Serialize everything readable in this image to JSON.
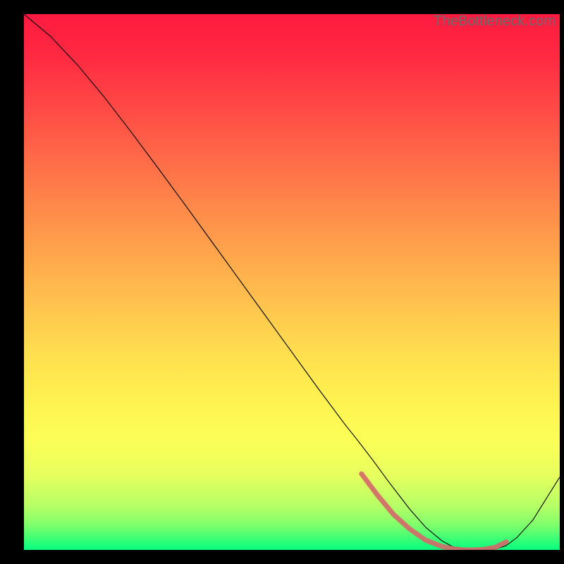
{
  "watermark": "TheBottleneck.com",
  "chart_data": {
    "type": "line",
    "title": "",
    "xlabel": "",
    "ylabel": "",
    "xlim": [
      0,
      100
    ],
    "ylim": [
      0,
      100
    ],
    "grid": false,
    "series": [
      {
        "name": "curve",
        "color": "#000000",
        "width": 1.1,
        "x": [
          0,
          5,
          10,
          15,
          20,
          25,
          30,
          35,
          40,
          45,
          50,
          55,
          60,
          62,
          65,
          68,
          70,
          72,
          75,
          78,
          80,
          82,
          85,
          88,
          90,
          92,
          95,
          100
        ],
        "y": [
          100,
          95.8,
          90.5,
          84.5,
          78.0,
          71.3,
          64.5,
          57.6,
          50.7,
          43.8,
          36.9,
          30.0,
          23.3,
          20.8,
          16.9,
          12.8,
          10.2,
          7.6,
          4.2,
          1.7,
          0.6,
          0.15,
          0.0,
          0.15,
          0.8,
          2.3,
          5.6,
          13.6
        ]
      },
      {
        "name": "highlight-band",
        "color": "#d46a6a",
        "width": 7,
        "cap": "round",
        "x": [
          63,
          66,
          69,
          72,
          75,
          78,
          80,
          82,
          84,
          86,
          88,
          90
        ],
        "y": [
          14.2,
          10.2,
          6.6,
          3.9,
          1.8,
          0.65,
          0.2,
          0.0,
          0.0,
          0.12,
          0.5,
          1.5
        ]
      }
    ],
    "gradient_stops": [
      {
        "pos": 0.0,
        "color": "#ff1a3f"
      },
      {
        "pos": 0.08,
        "color": "#ff2a42"
      },
      {
        "pos": 0.2,
        "color": "#ff5246"
      },
      {
        "pos": 0.35,
        "color": "#ff864a"
      },
      {
        "pos": 0.5,
        "color": "#ffb64d"
      },
      {
        "pos": 0.62,
        "color": "#ffdb4f"
      },
      {
        "pos": 0.72,
        "color": "#fff250"
      },
      {
        "pos": 0.8,
        "color": "#fbff57"
      },
      {
        "pos": 0.86,
        "color": "#e7ff5e"
      },
      {
        "pos": 0.92,
        "color": "#b4ff66"
      },
      {
        "pos": 0.955,
        "color": "#7cff6c"
      },
      {
        "pos": 0.975,
        "color": "#48ff73"
      },
      {
        "pos": 0.99,
        "color": "#1fff7a"
      },
      {
        "pos": 1.0,
        "color": "#0aff7e"
      }
    ]
  }
}
